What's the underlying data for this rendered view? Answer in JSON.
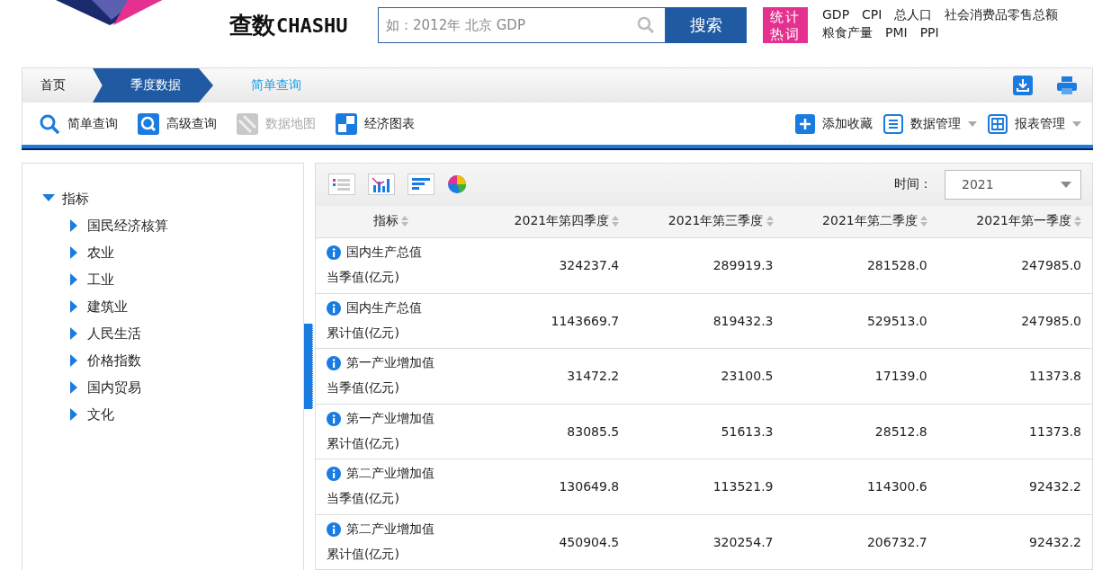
{
  "header": {
    "brand": {
      "cn": "查数",
      "en": "CHASHU"
    },
    "search": {
      "placeholder": "如：2012年 北京 GDP",
      "button": "搜索"
    },
    "hot_tag": "统计热词",
    "hot_words": [
      [
        "GDP",
        "CPI",
        "总人口",
        "社会消费品零售总额"
      ],
      [
        "粮食产量",
        "PMI",
        "PPI"
      ]
    ]
  },
  "breadcrumb": [
    {
      "label": "首页",
      "kind": "plain"
    },
    {
      "label": "季度数据",
      "kind": "active"
    },
    {
      "label": "简单查询",
      "kind": "current"
    }
  ],
  "toolbar": {
    "left": [
      {
        "label": "简单查询",
        "disabled": false
      },
      {
        "label": "高级查询",
        "disabled": false
      },
      {
        "label": "数据地图",
        "disabled": true
      },
      {
        "label": "经济图表",
        "disabled": false
      }
    ],
    "right": [
      {
        "label": "添加收藏",
        "has_menu": false
      },
      {
        "label": "数据管理",
        "has_menu": true
      },
      {
        "label": "报表管理",
        "has_menu": true
      }
    ]
  },
  "tree": [
    {
      "label": "指标",
      "expanded": true,
      "children": [
        {
          "label": "国民经济核算",
          "expanded": false
        },
        {
          "label": "农业",
          "expanded": false
        },
        {
          "label": "工业",
          "expanded": false
        },
        {
          "label": "建筑业",
          "expanded": false
        },
        {
          "label": "人民生活",
          "expanded": false
        },
        {
          "label": "价格指数",
          "expanded": false
        },
        {
          "label": "国内贸易",
          "expanded": false
        },
        {
          "label": "文化",
          "expanded": false
        }
      ]
    }
  ],
  "time_filter": {
    "label": "时间：",
    "value": "2021"
  },
  "table": {
    "columns": [
      "指标",
      "2021年第四季度",
      "2021年第三季度",
      "2021年第二季度",
      "2021年第一季度"
    ],
    "rows": [
      {
        "name": "国内生产总值",
        "unit": "当季值(亿元)",
        "values": [
          "324237.4",
          "289919.3",
          "281528.0",
          "247985.0"
        ]
      },
      {
        "name": "国内生产总值",
        "unit": "累计值(亿元)",
        "values": [
          "1143669.7",
          "819432.3",
          "529513.0",
          "247985.0"
        ]
      },
      {
        "name": "第一产业增加值",
        "unit": "当季值(亿元)",
        "values": [
          "31472.2",
          "23100.5",
          "17139.0",
          "11373.8"
        ]
      },
      {
        "name": "第一产业增加值",
        "unit": "累计值(亿元)",
        "values": [
          "83085.5",
          "51613.3",
          "28512.8",
          "11373.8"
        ]
      },
      {
        "name": "第二产业增加值",
        "unit": "当季值(亿元)",
        "values": [
          "130649.8",
          "113521.9",
          "114300.6",
          "92432.2"
        ]
      },
      {
        "name": "第二产业增加值",
        "unit": "累计值(亿元)",
        "values": [
          "450904.5",
          "320254.7",
          "206732.7",
          "92432.2"
        ]
      }
    ]
  }
}
